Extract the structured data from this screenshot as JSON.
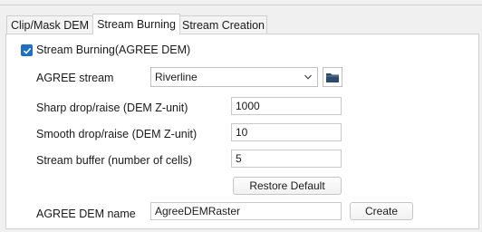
{
  "tabs": [
    {
      "label": "Clip/Mask DEM"
    },
    {
      "label": "Stream Burning"
    },
    {
      "label": "Stream Creation"
    }
  ],
  "stream_burning": {
    "enabled_label": "Stream Burning(AGREE DEM)",
    "enabled": true,
    "agree_stream_label": "AGREE stream",
    "agree_stream_value": "Riverline",
    "sharp_label": "Sharp drop/raise (DEM Z-unit)",
    "sharp_value": "1000",
    "smooth_label": "Smooth drop/raise (DEM Z-unit)",
    "smooth_value": "10",
    "buffer_label": "Stream buffer (number of cells)",
    "buffer_value": "5",
    "restore_label": "Restore Default",
    "dem_name_label": "AGREE DEM name",
    "dem_name_value": "AgreeDEMRaster",
    "create_label": "Create"
  },
  "colors": {
    "accent": "#1f6fc5",
    "folder": "#2d4a6b"
  },
  "icons": {
    "checkbox": "checkmark-icon",
    "dropdown": "chevron-down-icon",
    "browse": "folder-icon"
  }
}
